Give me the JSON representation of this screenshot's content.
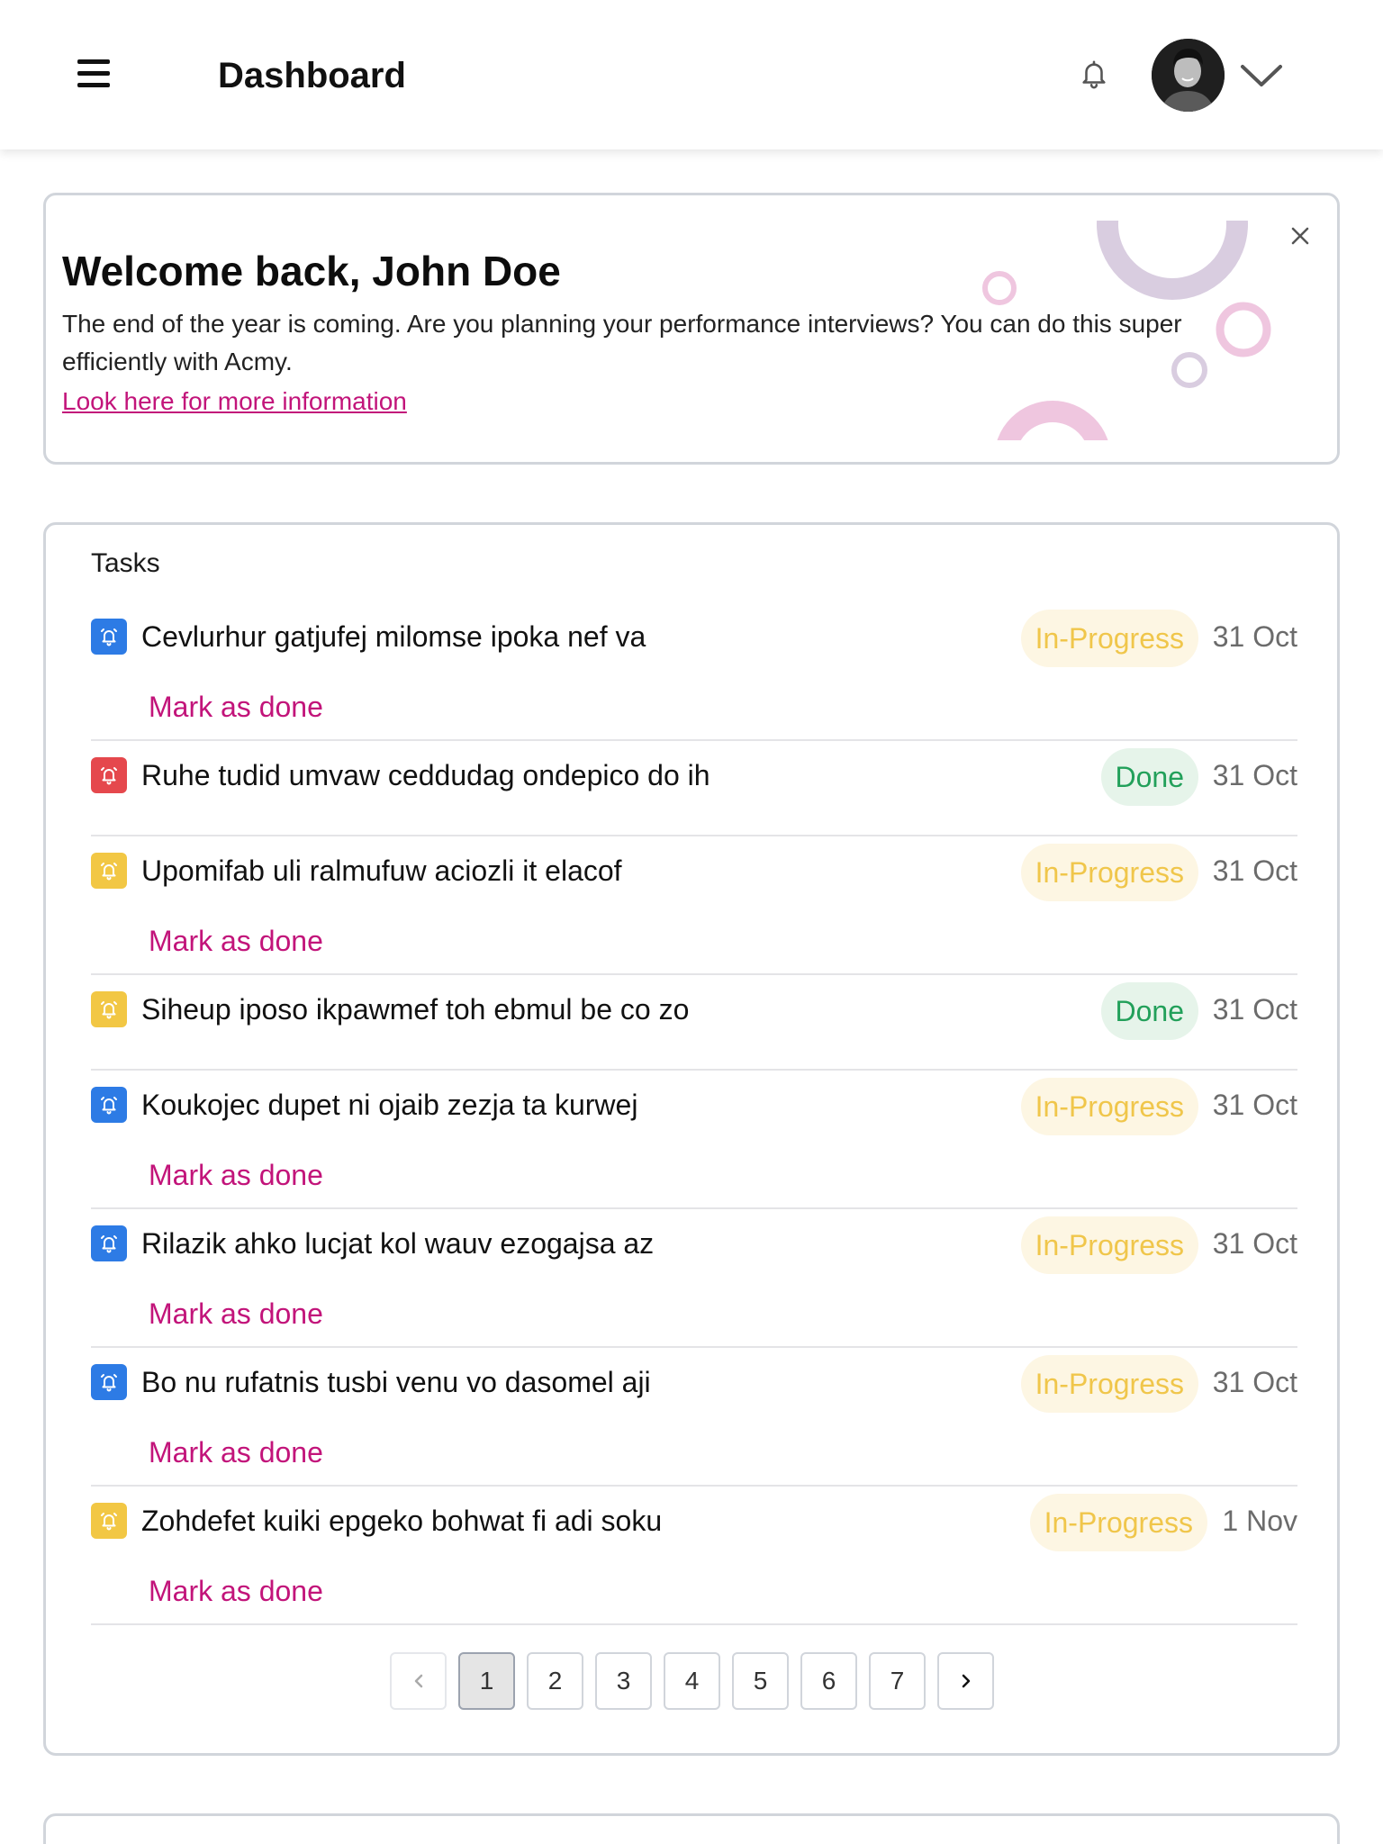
{
  "header": {
    "title": "Dashboard"
  },
  "welcome": {
    "heading": "Welcome back, John Doe",
    "body": "The end of the year is coming. Are you planning your performance interviews? You can do this super efficiently with Acmy.",
    "link_text": "Look here for more information"
  },
  "tasks": {
    "title": "Tasks",
    "action_label": "Mark as done",
    "items": [
      {
        "text": "Cevlurhur gatjufej milomse ipoka nef va",
        "status": "In-Progress",
        "status_kind": "inprogress",
        "date": "31 Oct",
        "icon_color": "#2d7be5",
        "has_action": true
      },
      {
        "text": "Ruhe tudid umvaw ceddudag ondepico do ih",
        "status": "Done",
        "status_kind": "done",
        "date": "31 Oct",
        "icon_color": "#e5484d",
        "has_action": false
      },
      {
        "text": "Upomifab uli ralmufuw aciozli it elacof",
        "status": "In-Progress",
        "status_kind": "inprogress",
        "date": "31 Oct",
        "icon_color": "#f2c744",
        "has_action": true
      },
      {
        "text": "Siheup iposo ikpawmef toh ebmul be co zo",
        "status": "Done",
        "status_kind": "done",
        "date": "31 Oct",
        "icon_color": "#f2c744",
        "has_action": false
      },
      {
        "text": "Koukojec dupet ni ojaib zezja ta kurwej",
        "status": "In-Progress",
        "status_kind": "inprogress",
        "date": "31 Oct",
        "icon_color": "#2d7be5",
        "has_action": true
      },
      {
        "text": "Rilazik ahko lucjat kol wauv ezogajsa az",
        "status": "In-Progress",
        "status_kind": "inprogress",
        "date": "31 Oct",
        "icon_color": "#2d7be5",
        "has_action": true
      },
      {
        "text": "Bo nu rufatnis tusbi venu vo dasomel aji",
        "status": "In-Progress",
        "status_kind": "inprogress",
        "date": "31 Oct",
        "icon_color": "#2d7be5",
        "has_action": true
      },
      {
        "text": "Zohdefet kuiki epgeko bohwat fi adi soku",
        "status": "In-Progress",
        "status_kind": "inprogress",
        "date": "1 Nov",
        "icon_color": "#f2c744",
        "has_action": true
      }
    ]
  },
  "pagination": {
    "pages": [
      "1",
      "2",
      "3",
      "4",
      "5",
      "6",
      "7"
    ],
    "current": "1",
    "prev_icon": "chevron-left-icon",
    "next_icon": "chevron-right-icon"
  },
  "icons": {
    "menu": "hamburger-icon",
    "notifications": "bell-icon",
    "user_menu": "chevron-down-icon",
    "close": "close-icon",
    "task": "alarm-icon"
  },
  "colors": {
    "accent": "#c2147a",
    "in_progress_text": "#f0c64b",
    "in_progress_bg": "#fdf6e3",
    "done_text": "#22a05a",
    "done_bg": "#e6f4ea"
  }
}
